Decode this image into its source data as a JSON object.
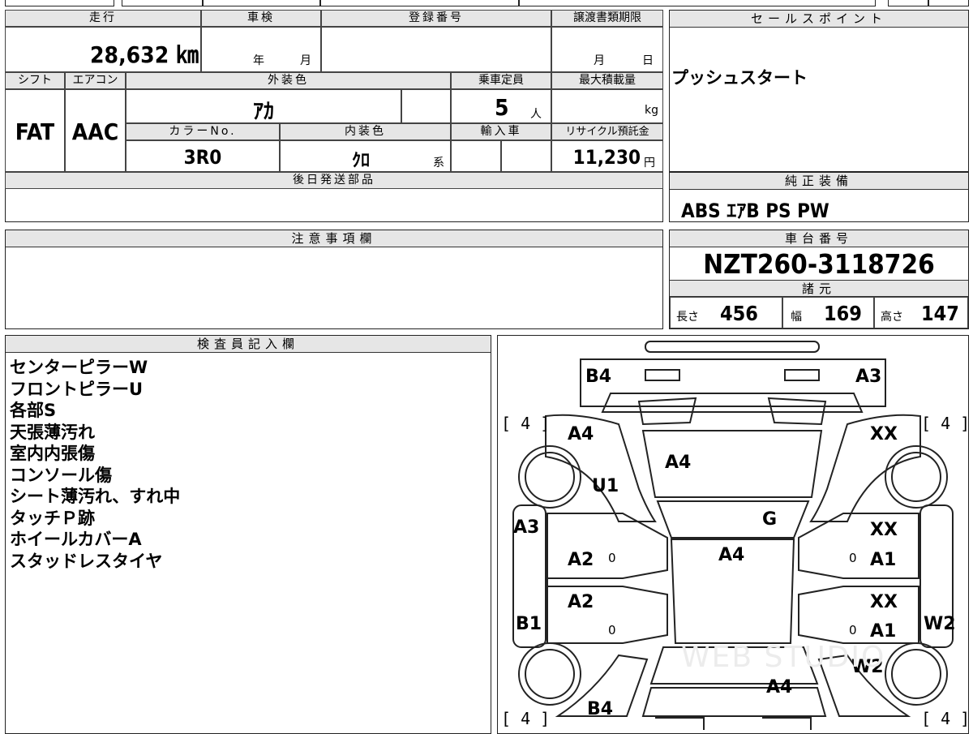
{
  "vehicle": {
    "mileage_label": "走行",
    "mileage": "28,632 ㎞",
    "shaken_label": "車検",
    "shaken_year_unit": "年",
    "shaken_month_unit": "月",
    "reg_no_label": "登録番号",
    "transfer_deadline_label": "譲渡書類期限",
    "transfer_month_unit": "月",
    "transfer_day_unit": "日",
    "shift_label": "シフト",
    "shift": "FAT",
    "aircon_label": "エアコン",
    "aircon": "AAC",
    "exterior_color_label": "外装色",
    "exterior_color": "ｱｶ",
    "capacity_label": "乗車定員",
    "capacity": "5",
    "capacity_unit": "人",
    "max_load_label": "最大積載量",
    "max_load_unit": "kg",
    "color_no_label": "カラーNo.",
    "color_no": "3R0",
    "interior_color_label": "内装色",
    "interior_color": "ｸﾛ",
    "interior_suffix": "系",
    "import_label": "輸入車",
    "recycle_label": "リサイクル預託金",
    "recycle_fee": "11,230",
    "recycle_unit": "円",
    "later_parts_label": "後日発送部品"
  },
  "sales_point": {
    "label": "セールスポイント",
    "text": "プッシュスタート"
  },
  "equipment": {
    "label": "純正装備",
    "text": "ABS ｴｱB PS PW"
  },
  "caution": {
    "label": "注意事項欄"
  },
  "chassis": {
    "label": "車台番号",
    "number": "NZT260-3118726",
    "spec_label": "諸元",
    "length_label": "長さ",
    "length": "456",
    "width_label": "幅",
    "width": "169",
    "height_label": "高さ",
    "height": "147"
  },
  "inspector": {
    "label": "検査員記入欄",
    "notes": [
      "センターピラーW",
      "フロントピラーU",
      "各部S",
      "天張薄汚れ",
      "室内内張傷",
      "コンソール傷",
      "シート薄汚れ、すれ中",
      "タッチＰ跡",
      "ホイールカバーA",
      "スタッドレスタイヤ"
    ]
  },
  "diagram": {
    "tire_front_left": "[ 4 ]",
    "tire_front_right": "[ 4 ]",
    "tire_rear_left": "[ 4 ]",
    "tire_rear_right": "[ 4 ]",
    "marks": {
      "front_left_corner": "B4",
      "front_right_corner": "A3",
      "left_front_fender": "A4",
      "bonnet": "A4",
      "right_front_fender": "XX",
      "left_front_fender_2": "U1",
      "windshield": "G",
      "left_pillar": "A3",
      "left_front_door": "A2",
      "roof": "A4",
      "right_front_door_top": "XX",
      "right_front_door": "A1",
      "left_rear_door": "A2",
      "right_rear_door_top": "XX",
      "right_rear_door": "A1",
      "left_rocker": "B1",
      "right_rocker": "W2",
      "right_rear_fender": "W2",
      "trunk": "A4",
      "rear_bumper": "B4"
    },
    "zero": "0",
    "watermark": "WEB STUDIO"
  }
}
